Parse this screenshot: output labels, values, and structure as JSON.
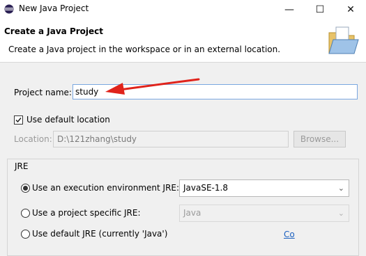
{
  "window": {
    "title": "New Java Project",
    "minimize_glyph": "—",
    "maximize_glyph": "☐",
    "close_glyph": "✕"
  },
  "header": {
    "title": "Create a Java Project",
    "description": "Create a Java project in the workspace or in an external location."
  },
  "project_name": {
    "label": "Project name:",
    "value": "study"
  },
  "default_location": {
    "label": "Use default location",
    "checked": true
  },
  "location": {
    "label": "Location:",
    "value": "D:\\121zhang\\study",
    "browse_label": "Browse..."
  },
  "jre": {
    "group_label": "JRE",
    "options": [
      {
        "label": "Use an execution environment JRE:",
        "selected": true,
        "select_value": "JavaSE-1.8",
        "enabled": true
      },
      {
        "label": "Use a project specific JRE:",
        "selected": false,
        "select_value": "Java",
        "enabled": false
      },
      {
        "label": "Use default JRE (currently 'Java')",
        "selected": false
      }
    ],
    "configure_link": "Co"
  },
  "colors": {
    "annotation_arrow": "#e0231b",
    "link": "#1a5fbf",
    "focus_border": "#7aa7e0"
  },
  "icons": {
    "app": "eclipse-icon",
    "banner": "folder-icon",
    "checkbox": "checkmark-icon",
    "dropdown": "chevron-down-icon"
  }
}
